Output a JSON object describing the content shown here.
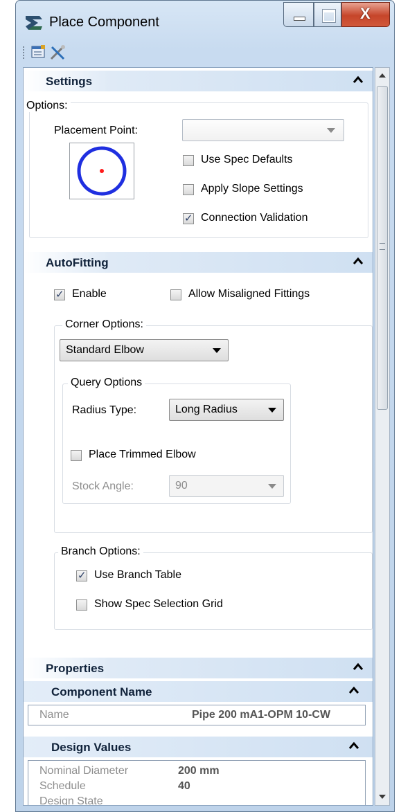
{
  "window": {
    "title": "Place Component",
    "close_glyph": "X"
  },
  "toolbar": {
    "icons": [
      "properties-icon",
      "tools-icon"
    ]
  },
  "settings": {
    "title": "Settings",
    "options_label": "Options:",
    "placement_point_label": "Placement Point:",
    "placement_point_value": "",
    "use_spec_defaults": {
      "label": "Use Spec Defaults",
      "checked": false
    },
    "apply_slope_settings": {
      "label": "Apply Slope Settings",
      "checked": false
    },
    "connection_validation": {
      "label": "Connection Validation",
      "checked": true
    }
  },
  "autofitting": {
    "title": "AutoFitting",
    "enable": {
      "label": "Enable",
      "checked": true
    },
    "allow_misaligned": {
      "label": "Allow Misaligned Fittings",
      "checked": false
    },
    "corner_options_label": "Corner Options:",
    "corner_value": "Standard Elbow",
    "query_options_label": "Query Options",
    "radius_type_label": "Radius Type:",
    "radius_type_value": "Long Radius",
    "place_trimmed_elbow": {
      "label": "Place Trimmed Elbow",
      "checked": false
    },
    "stock_angle_label": "Stock Angle:",
    "stock_angle_value": "90",
    "branch_options_label": "Branch Options:",
    "use_branch_table": {
      "label": "Use Branch Table",
      "checked": true
    },
    "show_spec_grid": {
      "label": "Show Spec Selection Grid",
      "checked": false
    }
  },
  "properties": {
    "title": "Properties",
    "component_name": {
      "title": "Component Name",
      "name_label": "Name",
      "name_value": "Pipe 200 mA1-OPM 10-CW"
    },
    "design_values": {
      "title": "Design Values",
      "rows": [
        {
          "label": "Nominal Diameter",
          "value": "200 mm"
        },
        {
          "label": "Schedule",
          "value": "40"
        },
        {
          "label": "Design State",
          "value": ""
        }
      ]
    }
  }
}
